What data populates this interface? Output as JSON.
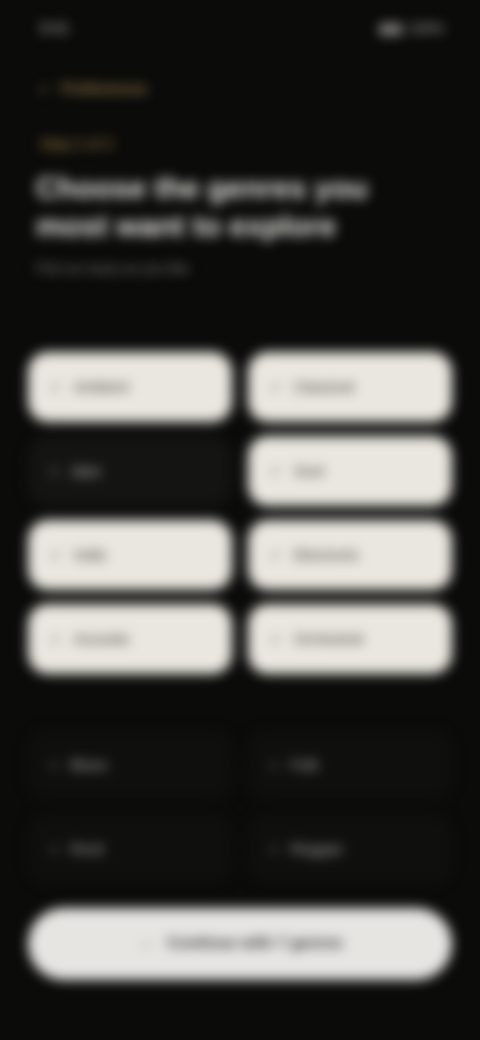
{
  "status": {
    "time": "9:41",
    "signal": "▮▮▮",
    "battery": "100%"
  },
  "nav": {
    "back_label": "Preferences"
  },
  "step": {
    "label": "Step 2 of 3"
  },
  "title": "Choose the genres you most want to explore",
  "subtitle": "Pick as many as you like",
  "options": [
    {
      "label": "Ambient"
    },
    {
      "label": "Classical"
    },
    {
      "label": "Jazz"
    },
    {
      "label": "Soul"
    },
    {
      "label": "Indie"
    },
    {
      "label": "Electronic"
    },
    {
      "label": "Acoustic"
    },
    {
      "label": "Orchestral"
    }
  ],
  "more_options": [
    {
      "label": "Blues"
    },
    {
      "label": "Folk"
    },
    {
      "label": "Rock"
    },
    {
      "label": "Reggae"
    }
  ],
  "continue": {
    "label": "Continue with 7 genres"
  }
}
